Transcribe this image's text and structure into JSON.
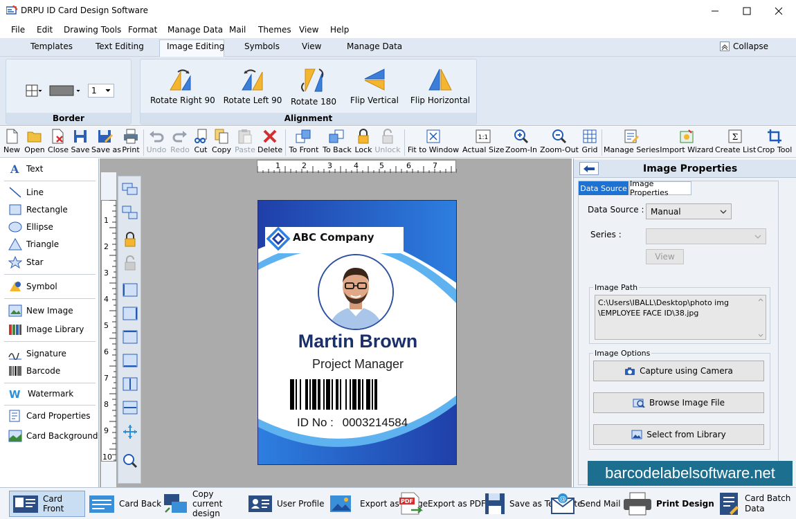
{
  "window": {
    "title": "DRPU ID Card Design Software"
  },
  "menu": [
    "File",
    "Edit",
    "Drawing Tools",
    "Format",
    "Manage Data",
    "Mail",
    "Themes",
    "View",
    "Help"
  ],
  "ribbon_tabs": [
    "Templates",
    "Text Editing",
    "Image Editing",
    "Symbols",
    "View",
    "Manage Data"
  ],
  "ribbon": {
    "collapse_label": "Collapse",
    "border_group_label": "Border",
    "border_width_value": "1",
    "alignment_group_label": "Alignment",
    "buttons": [
      "Rotate Right 90",
      "Rotate Left 90",
      "Rotate 180",
      "Flip Vertical",
      "Flip Horizontal"
    ]
  },
  "toolbar": [
    "New",
    "Open",
    "Close",
    "Save",
    "Save as",
    "Print",
    "Undo",
    "Redo",
    "Cut",
    "Copy",
    "Paste",
    "Delete",
    "To Front",
    "To Back",
    "Lock",
    "Unlock",
    "Fit to Window",
    "Actual Size",
    "Zoom-In",
    "Zoom-Out",
    "Grid",
    "Manage Series",
    "Import Wizard",
    "Create List",
    "Crop Tool"
  ],
  "left_panel": [
    "Text",
    "Line",
    "Rectangle",
    "Ellipse",
    "Triangle",
    "Star",
    "Symbol",
    "New Image",
    "Image Library",
    "Signature",
    "Barcode",
    "Watermark",
    "Card Properties",
    "Card Background"
  ],
  "ruler": {
    "h": [
      "1",
      "2",
      "3",
      "4",
      "5",
      "6",
      "7"
    ],
    "v": [
      "1",
      "2",
      "3",
      "4",
      "5",
      "6",
      "7",
      "8",
      "9",
      "10"
    ]
  },
  "card": {
    "company": "ABC Company",
    "name": "Martin Brown",
    "role": "Project Manager",
    "id_label": "ID No :",
    "id_value": "0003214584"
  },
  "right_panel": {
    "title": "Image Properties",
    "tabs": [
      "Data Source",
      "Image Properties"
    ],
    "data_source_label": "Data Source :",
    "data_source_value": "Manual",
    "series_label": "Series :",
    "view_button": "View",
    "image_path_label": "Image Path",
    "image_path_line1": "C:\\Users\\IBALL\\Desktop\\photo img",
    "image_path_line2": "\\EMPLOYEE FACE ID\\38.jpg",
    "image_options_label": "Image Options",
    "capture_button": "Capture using Camera",
    "browse_button": "Browse Image File",
    "library_button": "Select from Library"
  },
  "watermark": "barcodelabelsoftware.net",
  "bottom_bar": [
    "Card Front",
    "Card Back",
    "Copy current design",
    "User Profile",
    "Export as Image",
    "Export as PDF",
    "Save as Template",
    "Send Mail",
    "Print Design",
    "Card Batch Data"
  ],
  "colors": {
    "accent": "#1e5bb8",
    "card_blue": "#1f4fb3",
    "name_navy": "#1b2f6b",
    "ribbon_bg": "#dfe8f3"
  }
}
